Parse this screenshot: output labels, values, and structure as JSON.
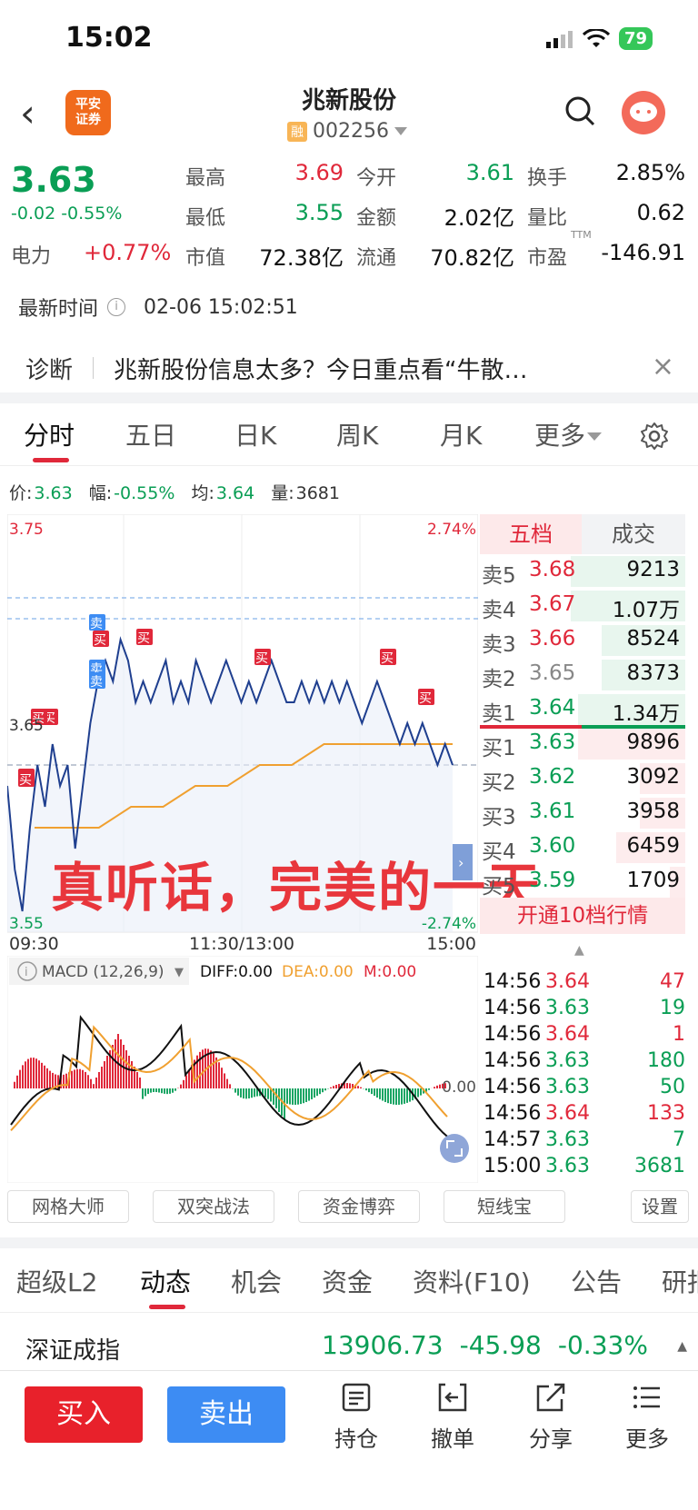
{
  "status_bar": {
    "time": "15:02",
    "battery": "79"
  },
  "header": {
    "back": "‹",
    "broker_logo_line1": "平安",
    "broker_logo_line2": "证券",
    "stock_name": "兆新股份",
    "rong_badge": "融",
    "stock_code": "002256"
  },
  "quote": {
    "price": "3.63",
    "change": "-0.02 -0.55%",
    "power_label": "电力",
    "power_change": "+0.77%",
    "cells": [
      {
        "label": "最高",
        "value": "3.69",
        "tone": "red"
      },
      {
        "label": "今开",
        "value": "3.61",
        "tone": "green"
      },
      {
        "label": "换手",
        "value": "2.85%",
        "tone": "black"
      },
      {
        "label": "最低",
        "value": "3.55",
        "tone": "green"
      },
      {
        "label": "金额",
        "value": "2.02亿",
        "tone": "black"
      },
      {
        "label": "量比",
        "value": "0.62",
        "tone": "black"
      },
      {
        "label": "市值",
        "value": "72.38亿",
        "tone": "black"
      },
      {
        "label": "流通",
        "value": "70.82亿",
        "tone": "black"
      },
      {
        "label": "市盈",
        "value": "-146.91",
        "tone": "black"
      }
    ],
    "pe_sup": "TTM",
    "latest_time_label": "最新时间",
    "latest_time": "02-06 15:02:51"
  },
  "diagnosis": {
    "label": "诊断",
    "text": "兆新股份信息太多？今日重点看“牛散…",
    "close": "×"
  },
  "chart_tabs": [
    "分时",
    "五日",
    "日K",
    "周K",
    "月K",
    "更多"
  ],
  "price_info": {
    "price_label": "价:",
    "price": "3.63",
    "range_label": "幅:",
    "range": "-0.55%",
    "avg_label": "均:",
    "avg": "3.64",
    "vol_label": "量:",
    "vol": "3681"
  },
  "chart_axis": {
    "top_price": "3.75",
    "top_pct": "2.74%",
    "mid_price": "3.65",
    "bottom_price": "3.55",
    "bottom_pct": "-2.74%",
    "t_start": "09:30",
    "t_mid": "11:30/13:00",
    "t_end": "15:00"
  },
  "chart_markers": {
    "buy": "买",
    "sell": "卖"
  },
  "macd": {
    "label": "MACD (12,26,9)",
    "diff": "DIFF:0.00",
    "dea": "DEA:0.00",
    "m": "M:0.00",
    "zero": "0.00"
  },
  "orderbook": {
    "tab_active": "五档",
    "tab_other": "成交",
    "rows": [
      {
        "label": "卖5",
        "price": "3.68",
        "vol": "9213",
        "tone": "red",
        "bar": 0.75
      },
      {
        "label": "卖4",
        "price": "3.67",
        "vol": "1.07万",
        "tone": "red",
        "bar": 0.75
      },
      {
        "label": "卖3",
        "price": "3.66",
        "vol": "8524",
        "tone": "red",
        "bar": 0.55
      },
      {
        "label": "卖2",
        "price": "3.65",
        "vol": "8373",
        "tone": "grey",
        "bar": 0.55
      },
      {
        "label": "卖1",
        "price": "3.64",
        "vol": "1.34万",
        "tone": "green",
        "bar": 0.7
      },
      {
        "label": "买1",
        "price": "3.63",
        "vol": "9896",
        "tone": "green",
        "bar": 0.7
      },
      {
        "label": "买2",
        "price": "3.62",
        "vol": "3092",
        "tone": "green",
        "bar": 0.3
      },
      {
        "label": "买3",
        "price": "3.61",
        "vol": "3958",
        "tone": "green",
        "bar": 0.3
      },
      {
        "label": "买4",
        "price": "3.60",
        "vol": "6459",
        "tone": "green",
        "bar": 0.45
      },
      {
        "label": "买5",
        "price": "3.59",
        "vol": "1709",
        "tone": "green",
        "bar": 0.1
      }
    ],
    "open_button": "开通10档行情"
  },
  "trades": [
    {
      "time": "14:56",
      "price": "3.64",
      "vol": "47",
      "tone": "red"
    },
    {
      "time": "14:56",
      "price": "3.63",
      "vol": "19",
      "tone": "green"
    },
    {
      "time": "14:56",
      "price": "3.64",
      "vol": "1",
      "tone": "red"
    },
    {
      "time": "14:56",
      "price": "3.63",
      "vol": "180",
      "tone": "green"
    },
    {
      "time": "14:56",
      "price": "3.63",
      "vol": "50",
      "tone": "green"
    },
    {
      "time": "14:56",
      "price": "3.64",
      "vol": "133",
      "tone": "red"
    },
    {
      "time": "14:57",
      "price": "3.63",
      "vol": "7",
      "tone": "green"
    },
    {
      "time": "15:00",
      "price": "3.63",
      "vol": "3681",
      "tone": "green"
    }
  ],
  "overlay_text": "真听话，完美的一天",
  "tools": [
    "网格大师",
    "双突战法",
    "资金博弈",
    "短线宝",
    "设置"
  ],
  "section_tabs": [
    "超级L2",
    "动态",
    "机会",
    "资金",
    "资料(F10)",
    "公告",
    "研报"
  ],
  "index": {
    "name": "深证成指",
    "value": "13906.73",
    "change": "-45.98",
    "pct": "-0.33%"
  },
  "bottom_bar": {
    "buy": "买入",
    "sell": "卖出",
    "hold": "持仓",
    "cancel": "撤单",
    "share": "分享",
    "more": "更多"
  },
  "colors": {
    "red": "#e0283a",
    "green": "#0a9e55",
    "price_line": "#1f3f8f",
    "avg_line": "#f0a030",
    "buy_blue": "#3d8cf3"
  }
}
